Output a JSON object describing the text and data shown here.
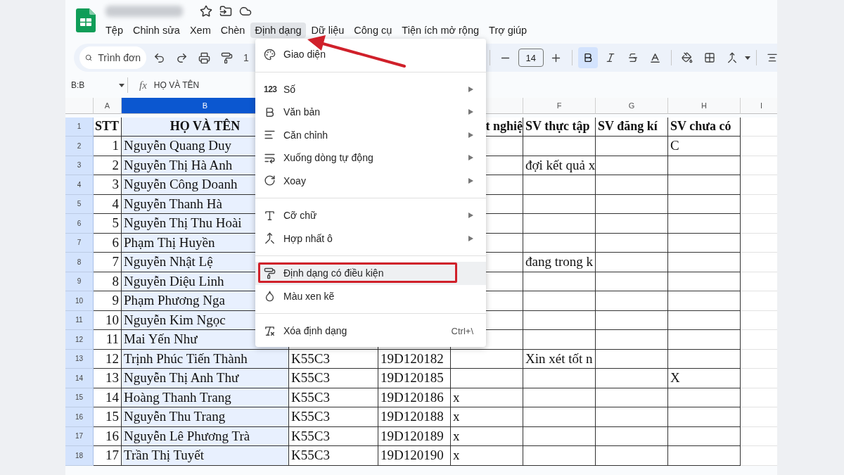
{
  "menubar": [
    {
      "label": "Tệp",
      "selected": false
    },
    {
      "label": "Chỉnh sửa",
      "selected": false
    },
    {
      "label": "Xem",
      "selected": false
    },
    {
      "label": "Chèn",
      "selected": false
    },
    {
      "label": "Định dạng",
      "selected": true
    },
    {
      "label": "Dữ liệu",
      "selected": false
    },
    {
      "label": "Công cụ",
      "selected": false
    },
    {
      "label": "Tiện ích mở rộng",
      "selected": false
    },
    {
      "label": "Trợ giúp",
      "selected": false
    }
  ],
  "toolbar": {
    "search_placeholder": "Trình đơn",
    "zoom_fragment": "1",
    "font_size": "14",
    "bold": true
  },
  "formula_bar": {
    "name_box": "B:B",
    "fx": "fx",
    "value": "HỌ VÀ TÊN"
  },
  "grid": {
    "columns": [
      {
        "label": "A",
        "selected": false
      },
      {
        "label": "B",
        "selected": true
      },
      {},
      {},
      {},
      {
        "label": "F",
        "selected": false
      },
      {
        "label": "G",
        "selected": false
      },
      {
        "label": "H",
        "selected": false
      },
      {
        "label": "I",
        "selected": false
      }
    ],
    "header_row": {
      "number": "1",
      "cells": {
        "a": "STT",
        "b": "HỌ VÀ TÊN",
        "e": "t nghiệ",
        "f": "SV thực tập",
        "g": "SV đăng kí",
        "h": "SV chưa có"
      }
    },
    "rows": [
      {
        "number": "2",
        "cells": {
          "a": "1",
          "b": "Nguyễn Quang Duy",
          "h": "C"
        }
      },
      {
        "number": "3",
        "cells": {
          "a": "2",
          "b": "Nguyễn Thị Hà Anh",
          "f": "đợi kết quả x"
        }
      },
      {
        "number": "4",
        "cells": {
          "a": "3",
          "b": "Nguyễn Công Doanh"
        }
      },
      {
        "number": "5",
        "cells": {
          "a": "4",
          "b": "Nguyễn Thanh Hà"
        }
      },
      {
        "number": "6",
        "cells": {
          "a": "5",
          "b": "Nguyễn Thị Thu Hoài"
        }
      },
      {
        "number": "7",
        "cells": {
          "a": "6",
          "b": "Phạm Thị Huyền"
        }
      },
      {
        "number": "8",
        "cells": {
          "a": "7",
          "b": "Nguyễn Nhật Lệ",
          "f": "đang trong k"
        }
      },
      {
        "number": "9",
        "cells": {
          "a": "8",
          "b": "Nguyễn Diệu Linh"
        }
      },
      {
        "number": "10",
        "cells": {
          "a": "9",
          "b": "Phạm Phương Nga"
        }
      },
      {
        "number": "11",
        "cells": {
          "a": "10",
          "b": "Nguyễn Kim Ngọc"
        }
      },
      {
        "number": "12",
        "cells": {
          "a": "11",
          "b": "Mai Yến Như"
        }
      },
      {
        "number": "13",
        "cells": {
          "a": "12",
          "b": "Trịnh Phúc Tiến Thành",
          "c": "K55C3",
          "d": "19D120182",
          "f": "Xin xét tốt n"
        }
      },
      {
        "number": "14",
        "cells": {
          "a": "13",
          "b": "Nguyễn Thị Anh Thư",
          "c": "K55C3",
          "d": "19D120185",
          "h": "X"
        }
      },
      {
        "number": "15",
        "cells": {
          "a": "14",
          "b": "Hoàng Thanh Trang",
          "c": "K55C3",
          "d": "19D120186",
          "e": "x"
        }
      },
      {
        "number": "16",
        "cells": {
          "a": "15",
          "b": "Nguyễn Thu Trang",
          "c": "K55C3",
          "d": "19D120188",
          "e": "x"
        }
      },
      {
        "number": "17",
        "cells": {
          "a": "16",
          "b": "Nguyễn Lê Phương Trà",
          "c": "K55C3",
          "d": "19D120189",
          "e": "x"
        }
      },
      {
        "number": "18",
        "cells": {
          "a": "17",
          "b": "Trần Thị Tuyết",
          "c": "K55C3",
          "d": "19D120190",
          "e": "x"
        }
      }
    ]
  },
  "menu": {
    "items": [
      {
        "kind": "item",
        "label": "Giao diện",
        "submenu": false,
        "highlighted": false,
        "annotated": false
      },
      {
        "kind": "separator"
      },
      {
        "kind": "item",
        "glyph": "123",
        "label": "Số",
        "submenu": true,
        "highlighted": false,
        "annotated": false
      },
      {
        "kind": "item",
        "label": "Văn bản",
        "submenu": true,
        "highlighted": false,
        "annotated": false
      },
      {
        "kind": "item",
        "label": "Căn chỉnh",
        "submenu": true,
        "highlighted": false,
        "annotated": false
      },
      {
        "kind": "item",
        "label": "Xuống dòng tự động",
        "submenu": true,
        "highlighted": false,
        "annotated": false
      },
      {
        "kind": "item",
        "label": "Xoay",
        "submenu": true,
        "highlighted": false,
        "annotated": false
      },
      {
        "kind": "separator"
      },
      {
        "kind": "item",
        "label": "Cỡ chữ",
        "submenu": true,
        "highlighted": false,
        "annotated": false
      },
      {
        "kind": "item",
        "label": "Hợp nhất ô",
        "submenu": true,
        "highlighted": false,
        "annotated": false
      },
      {
        "kind": "separator"
      },
      {
        "kind": "item",
        "label": "Định dạng có điều kiện",
        "submenu": false,
        "highlighted": true,
        "annotated": true
      },
      {
        "kind": "item",
        "label": "Màu xen kẽ",
        "submenu": false,
        "highlighted": false,
        "annotated": false
      },
      {
        "kind": "separator"
      },
      {
        "kind": "item",
        "label": "Xóa định dạng",
        "submenu": false,
        "highlighted": false,
        "annotated": false,
        "shortcut": "Ctrl+\\"
      }
    ]
  }
}
